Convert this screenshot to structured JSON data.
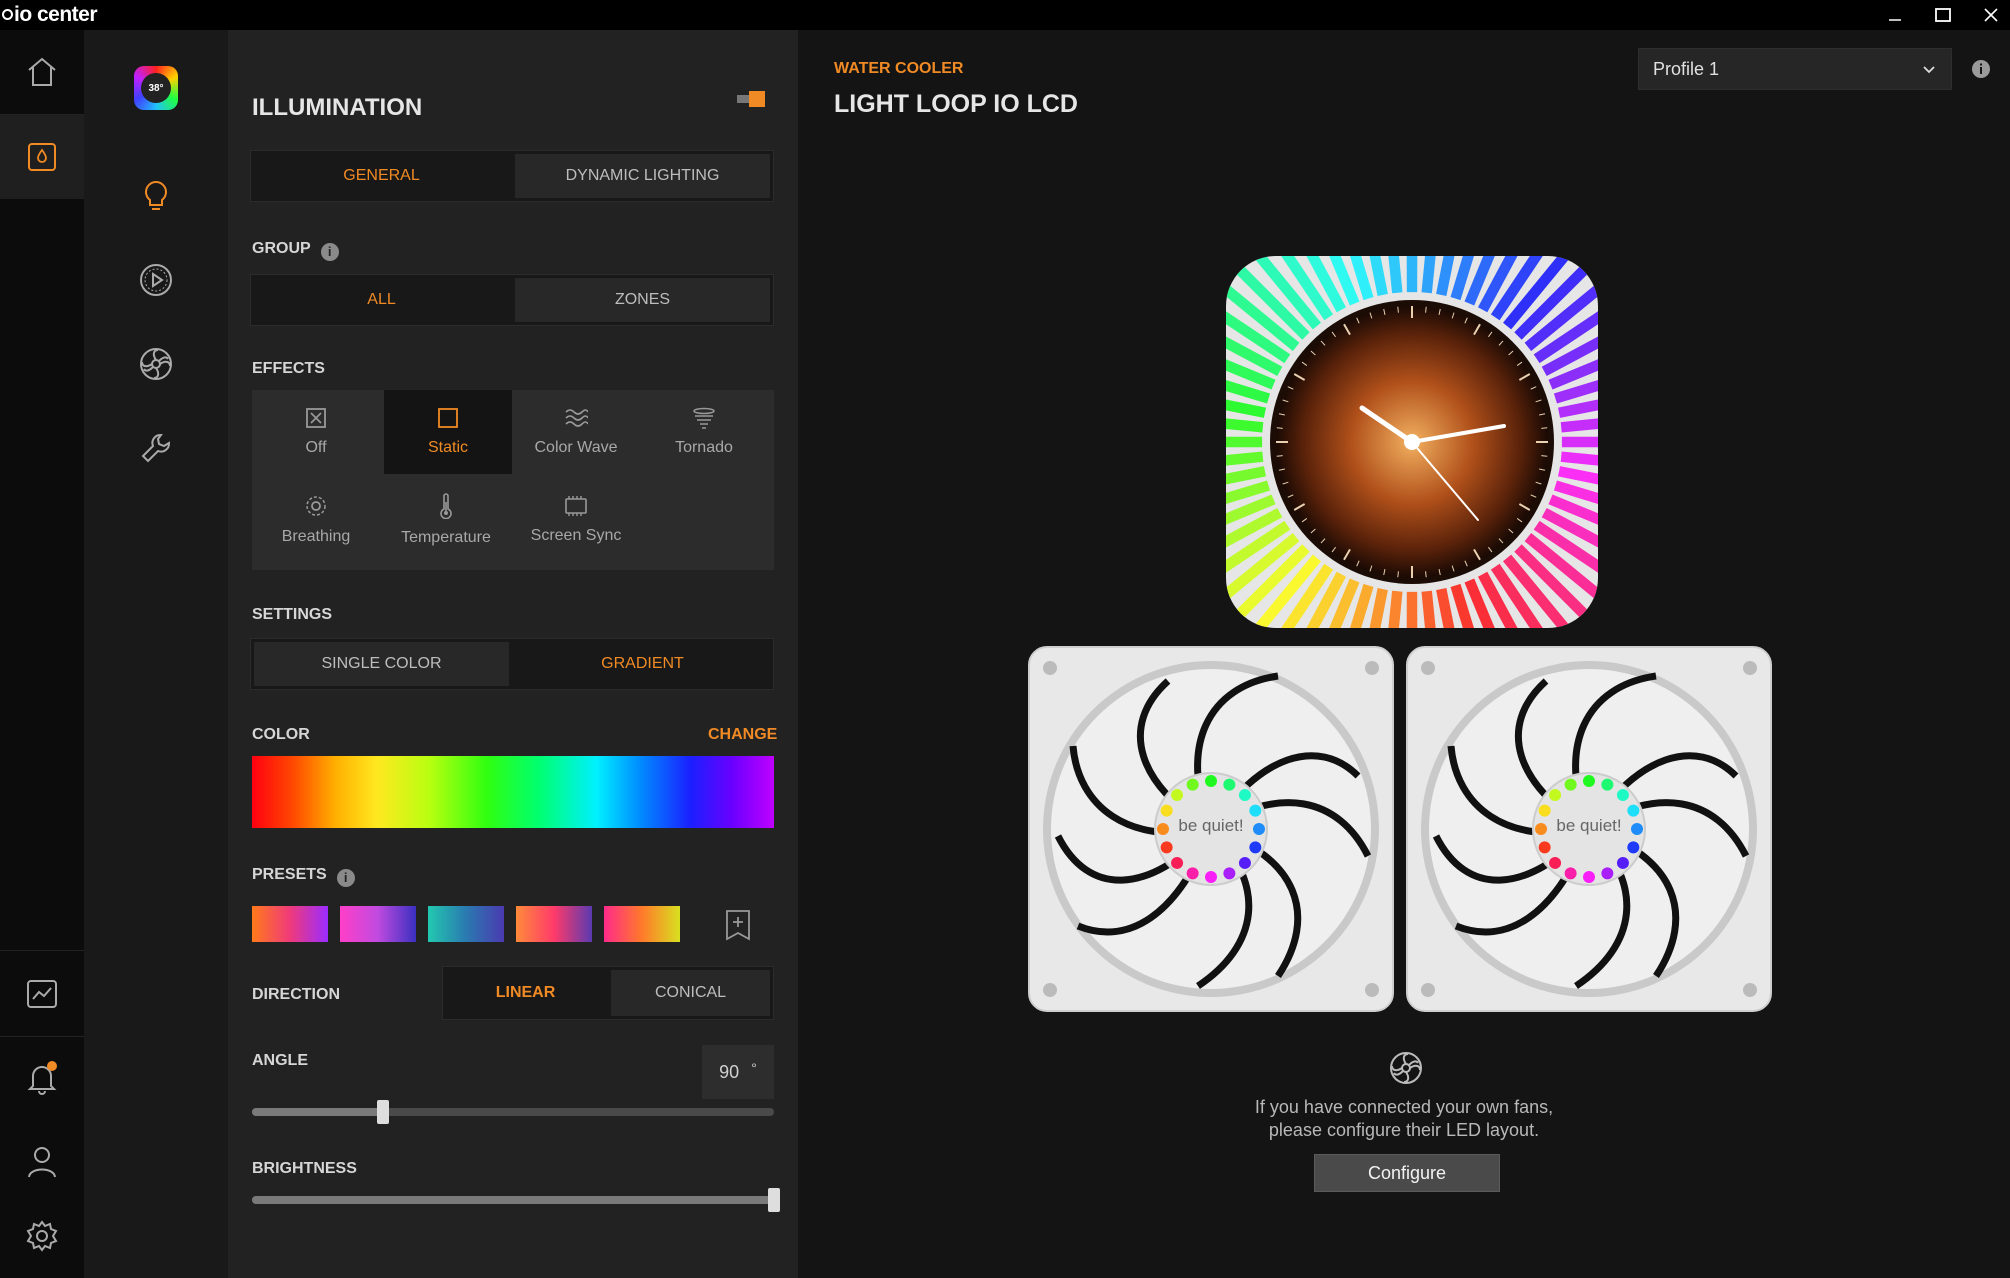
{
  "app": {
    "title": "io center"
  },
  "window_controls": [
    "minimize",
    "maximize",
    "close"
  ],
  "rail": {
    "items": [
      {
        "icon": "home-icon"
      },
      {
        "icon": "water-drop-icon",
        "active": true
      },
      {
        "icon": "chart-icon"
      },
      {
        "icon": "bell-icon",
        "badge": true
      },
      {
        "icon": "user-icon"
      },
      {
        "icon": "gear-icon"
      }
    ]
  },
  "sidebar": {
    "device_thumb_text": "38°",
    "items": [
      {
        "icon": "bulb-icon",
        "active": true
      },
      {
        "icon": "play-circle-icon"
      },
      {
        "icon": "fan-icon"
      },
      {
        "icon": "wrench-icon"
      }
    ]
  },
  "panel": {
    "title": "ILLUMINATION",
    "tabs": [
      {
        "label": "GENERAL",
        "selected": true
      },
      {
        "label": "DYNAMIC LIGHTING",
        "selected": false
      }
    ],
    "group": {
      "label": "GROUP",
      "options": [
        {
          "label": "ALL",
          "selected": true
        },
        {
          "label": "ZONES",
          "selected": false
        }
      ]
    },
    "effects": {
      "label": "EFFECTS",
      "items": [
        {
          "label": "Off",
          "icon": "off-icon",
          "selected": false
        },
        {
          "label": "Static",
          "icon": "static-icon",
          "selected": true
        },
        {
          "label": "Color Wave",
          "icon": "wave-icon",
          "selected": false
        },
        {
          "label": "Tornado",
          "icon": "tornado-icon",
          "selected": false
        },
        {
          "label": "Breathing",
          "icon": "breathing-icon",
          "selected": false
        },
        {
          "label": "Temperature",
          "icon": "thermometer-icon",
          "selected": false
        },
        {
          "label": "Screen Sync",
          "icon": "screen-sync-icon",
          "selected": false
        }
      ]
    },
    "settings": {
      "label": "SETTINGS",
      "options": [
        {
          "label": "SINGLE COLOR",
          "selected": false
        },
        {
          "label": "GRADIENT",
          "selected": true
        }
      ]
    },
    "color": {
      "label": "COLOR",
      "change_label": "CHANGE"
    },
    "presets": {
      "label": "PRESETS",
      "swatches": [
        [
          "#ff7a1a",
          "#f03a7a",
          "#9b2cff"
        ],
        [
          "#ff3fc8",
          "#c04ae0",
          "#3a30c0"
        ],
        [
          "#22c8b0",
          "#2a7ab0",
          "#4a3ab0"
        ],
        [
          "#ff8a3a",
          "#ff3a6a",
          "#5a3ab0"
        ],
        [
          "#ff2a8a",
          "#ff7a2a",
          "#d8e020"
        ]
      ]
    },
    "direction": {
      "label": "DIRECTION",
      "options": [
        {
          "label": "LINEAR",
          "selected": true
        },
        {
          "label": "CONICAL",
          "selected": false
        }
      ]
    },
    "angle": {
      "label": "ANGLE",
      "value": "90",
      "unit": "°",
      "max": 360
    },
    "brightness": {
      "label": "BRIGHTNESS",
      "value_fraction": 1.0
    }
  },
  "main": {
    "category": "WATER COOLER",
    "device": "LIGHT LOOP IO LCD",
    "profile": {
      "selected": "Profile 1"
    },
    "fan_hub_text": "be quiet!",
    "hint_line1": "If you have connected your own fans,",
    "hint_line2": "please configure their LED layout.",
    "configure_label": "Configure"
  },
  "colors": {
    "accent": "#f08a24",
    "bg": "#141414",
    "panel": "#222222"
  }
}
